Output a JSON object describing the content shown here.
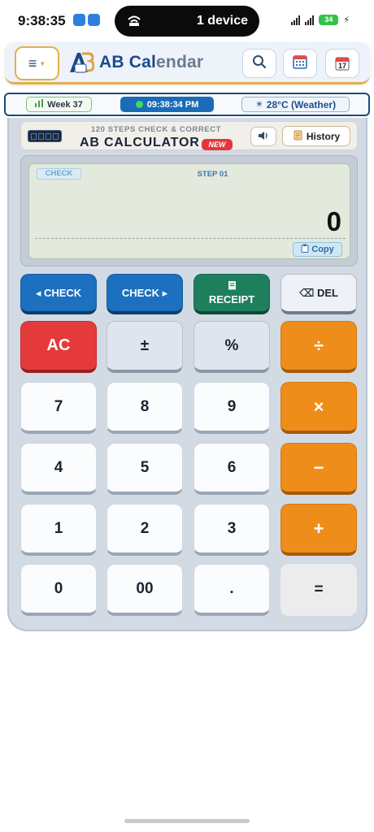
{
  "status_bar": {
    "time": "9:38:35",
    "island_text": "1 device",
    "battery": "34"
  },
  "header": {
    "title_part1": "AB Cal",
    "title_part2": "endar",
    "icons": [
      "menu-icon",
      "app-logo",
      "search-icon",
      "calendar-icon",
      "calendar-17-icon"
    ],
    "calendar_day": "17"
  },
  "info_bar": {
    "week": "Week 37",
    "clock": "09:38:34 PM",
    "weather": "28°C (Weather)"
  },
  "calculator": {
    "subtitle": "120 STEPS CHECK & CORRECT",
    "title": "AB CALCULATOR",
    "new_badge": "NEW",
    "history_label": "History",
    "display": {
      "check_tag": "CHECK",
      "step_label": "STEP 01",
      "value": "0",
      "copy_label": "Copy"
    },
    "keys": {
      "check_prev": "◂ CHECK",
      "check_next": "CHECK ▸",
      "receipt": "RECEIPT",
      "del": "⌫ DEL",
      "ac": "AC",
      "plus_minus": "±",
      "percent": "%",
      "divide": "÷",
      "seven": "7",
      "eight": "8",
      "nine": "9",
      "multiply": "×",
      "four": "4",
      "five": "5",
      "six": "6",
      "minus": "−",
      "one": "1",
      "two": "2",
      "three": "3",
      "plus": "+",
      "zero": "0",
      "double_zero": "00",
      "dot": ".",
      "equal": "="
    }
  },
  "colors": {
    "accent_blue": "#1c70bf",
    "accent_orange": "#ef8d1a",
    "accent_red": "#e53a3c",
    "accent_green": "#1e7f5c",
    "header_gold": "#e2b04a"
  }
}
